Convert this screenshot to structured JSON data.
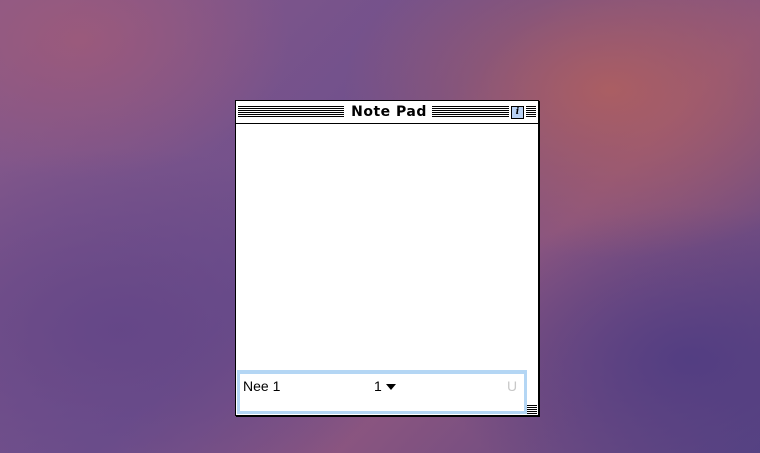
{
  "window": {
    "title": "Note Pad",
    "info_glyph": "i"
  },
  "footer": {
    "note_title": "Nee 1",
    "page_number": "1",
    "underline_glyph": "U"
  },
  "icons": {
    "info": "info-icon",
    "page_menu": "chevron-down-icon",
    "resize": "resize-grip-icon"
  }
}
